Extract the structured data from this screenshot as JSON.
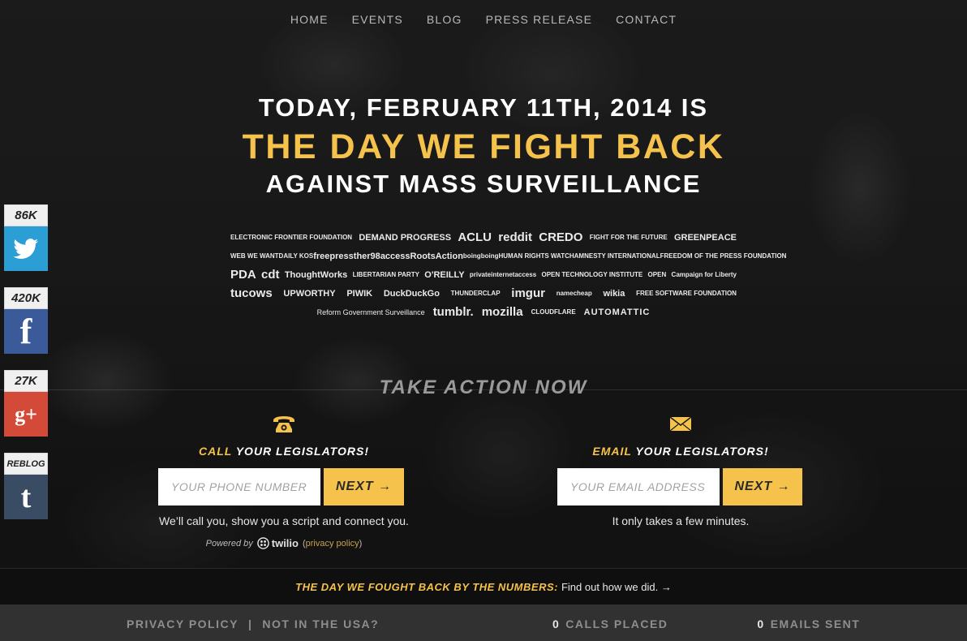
{
  "nav": [
    "HOME",
    "EVENTS",
    "BLOG",
    "PRESS RELEASE",
    "CONTACT"
  ],
  "hero": {
    "line1": "TODAY, FEBRUARY 11TH, 2014 IS",
    "line2": "THE DAY WE FIGHT BACK",
    "line3": "AGAINST MASS SURVEILLANCE"
  },
  "logos": {
    "row1": [
      "ELECTRONIC FRONTIER FOUNDATION",
      "DEMAND PROGRESS",
      "ACLU",
      "reddit",
      "CREDO",
      "FIGHT FOR THE FUTURE",
      "GREENPEACE"
    ],
    "row2": [
      "WEB WE WANT",
      "DAILY KOS",
      "freepress",
      "ther98",
      "access",
      "RootsAction",
      "boingboing",
      "HUMAN RIGHTS WATCH",
      "AMNESTY INTERNATIONAL",
      "FREEDOM OF THE PRESS FOUNDATION"
    ],
    "row3": [
      "PDA",
      "cdt",
      "ThoughtWorks",
      "LIBERTARIAN PARTY",
      "O'REILLY",
      "privateinternetaccess",
      "OPEN TECHNOLOGY INSTITUTE",
      "OPEN",
      "Campaign for Liberty"
    ],
    "row4": [
      "tucows",
      "UPWORTHY",
      "PIWIK",
      "DuckDuckGo",
      "THUNDERCLAP",
      "imgur",
      "namecheap",
      "wikia",
      "FREE SOFTWARE FOUNDATION"
    ],
    "row5": [
      "Reform Government Surveillance",
      "tumblr.",
      "mozilla",
      "CLOUDFLARE",
      "AUTOMATTIC"
    ]
  },
  "social": {
    "twitter": {
      "count": "86K",
      "icon": "twitter-icon"
    },
    "facebook": {
      "count": "420K",
      "glyph": "f",
      "icon": "facebook-icon"
    },
    "google": {
      "count": "27K",
      "glyph": "g+",
      "icon": "google-plus-icon"
    },
    "tumblr": {
      "count": "REBLOG",
      "glyph": "t",
      "icon": "tumblr-icon"
    }
  },
  "take_action": "TAKE ACTION NOW",
  "call": {
    "accent": "CALL",
    "heading_rest": " YOUR LEGISLATORS!",
    "placeholder": "YOUR PHONE NUMBER",
    "button": "NEXT →",
    "note": "We’ll call you, show you a script and connect you.",
    "powered_by": "Powered by",
    "twilio": "twilio",
    "privacy_open": "(",
    "privacy": "privacy policy",
    "privacy_close": ")"
  },
  "email": {
    "accent": "EMAIL",
    "heading_rest": " YOUR LEGISLATORS!",
    "placeholder": "YOUR EMAIL ADDRESS",
    "button": "NEXT →",
    "note": "It only takes a few minutes."
  },
  "numbers": {
    "heading": "THE DAY WE FOUGHT BACK BY THE NUMBERS:",
    "link": "Find out how we did. →"
  },
  "footer": {
    "privacy": "PRIVACY POLICY",
    "sep": "|",
    "not_usa": "NOT IN THE USA?",
    "calls_num": "0",
    "calls_label": "CALLS PLACED",
    "emails_num": "0",
    "emails_label": "EMAILS SENT"
  },
  "colors": {
    "accent": "#f5c24c",
    "twitter": "#2b9ed6",
    "facebook": "#3b5a9a",
    "google": "#d44a38",
    "tumblr": "#3a4c63"
  }
}
